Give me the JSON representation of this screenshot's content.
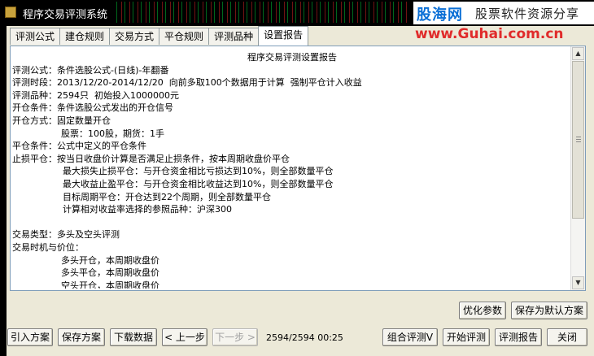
{
  "window": {
    "title": "程序交易评测系统"
  },
  "watermark": {
    "logo_text": "股海网",
    "tagline": "股票软件资源分享",
    "url": "www.Guhai.com.cn"
  },
  "tabs": [
    "评测公式",
    "建仓规则",
    "交易方式",
    "平仓规则",
    "评测品种",
    "设置报告"
  ],
  "report": {
    "title": "程序交易评测设置报告",
    "lines": [
      "评测公式：条件选股公式-(日线)-年翻番",
      "评测时段：2013/12/20-2014/12/20  向前多取100个数据用于计算  强制平仓计入收益",
      "评测品种：2594只  初始投入1000000元",
      "开仓条件：条件选股公式发出的开仓信号",
      "开仓方式：固定数量开仓",
      "股票：100股，期货：1手",
      "平仓条件：公式中定义的平仓条件",
      "止损平仓：按当日收盘价计算是否满足止损条件，按本周期收盘价平仓",
      "最大损失止损平仓：与开仓资金相比亏损达到10%，则全部数量平仓",
      "最大收益止盈平仓：与开仓资金相比收益达到10%，则全部数量平仓",
      "目标周期平仓：开仓达到22个周期，则全部数量平仓",
      "计算相对收益率选择的参照品种：沪深300",
      "",
      "交易类型：多头及空头评测",
      "交易时机与价位：",
      "多头开仓，本周期收盘价",
      "多头平仓，本周期收盘价",
      "空头开仓，本周期收盘价"
    ]
  },
  "panel_buttons": {
    "optimize": "优化参数",
    "save_default": "保存为默认方案"
  },
  "bottom_buttons": {
    "import": "引入方案",
    "save": "保存方案",
    "download": "下载数据",
    "prev": "< 上一步",
    "next": "下一步 >",
    "combo": "组合评测V",
    "start": "开始评测",
    "report": "评测报告",
    "close": "关闭"
  },
  "status": {
    "progress": "2594/2594 00:25"
  }
}
